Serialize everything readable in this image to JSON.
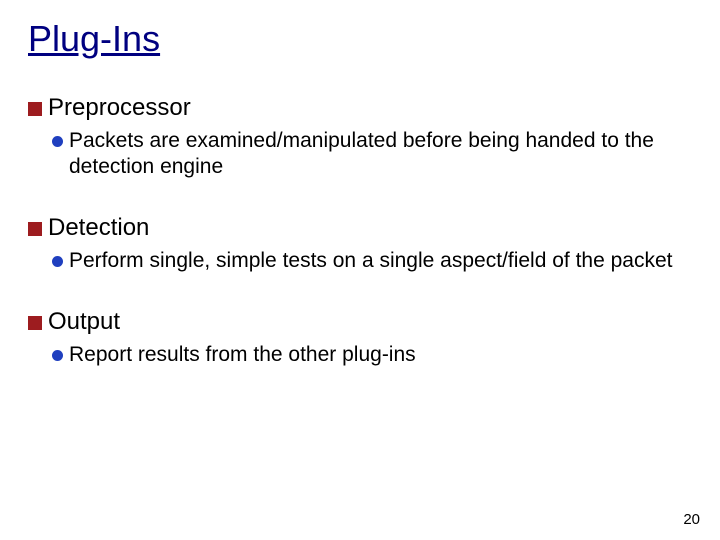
{
  "title": "Plug-Ins",
  "sections": [
    {
      "heading": "Preprocessor",
      "items": [
        "Packets are examined/manipulated before being handed to the detection engine"
      ]
    },
    {
      "heading": "Detection",
      "items": [
        "Perform single, simple tests on a single aspect/field of the packet"
      ]
    },
    {
      "heading": "Output",
      "items": [
        "Report results from the other plug-ins"
      ]
    }
  ],
  "page_number": "20"
}
